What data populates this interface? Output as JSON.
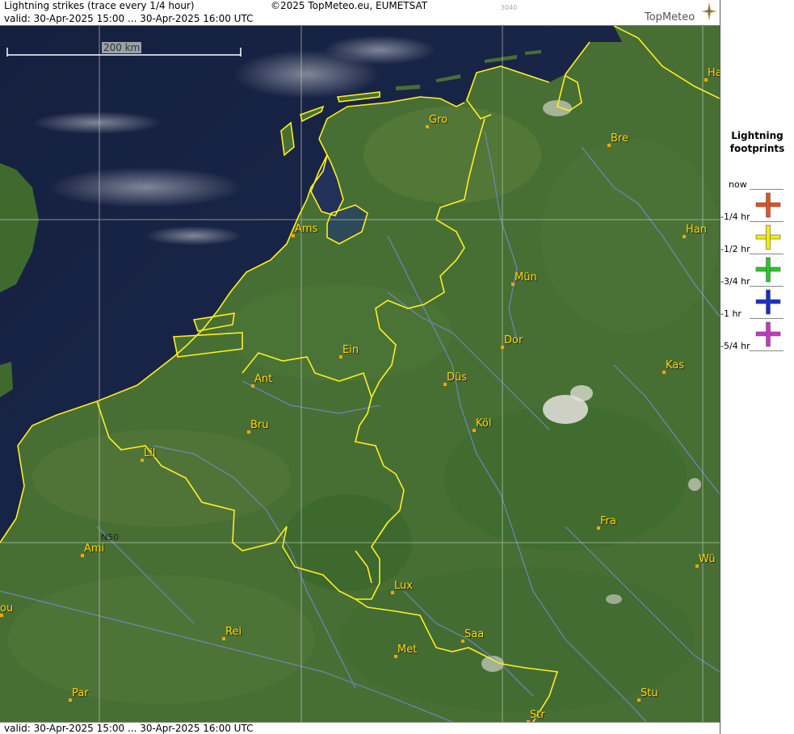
{
  "header": {
    "title": "Lightning strikes (trace every 1/4 hour)",
    "copyright": "©2025 TopMeteo.eu, EUMETSAT",
    "valid": "valid:  30-Apr-2025 15:00 ... 30-Apr-2025 16:00 UTC",
    "small_code": "3040",
    "brand": "TopMeteo"
  },
  "footer": {
    "valid": "valid:  30-Apr-2025 15:00 ... 30-Apr-2025 16:00 UTC"
  },
  "map": {
    "scale_label": "200 km",
    "lat_label": "N50",
    "cities": [
      {
        "name": "Gro",
        "key": "gro"
      },
      {
        "name": "Bre",
        "key": "bre"
      },
      {
        "name": "Ha",
        "key": "ham"
      },
      {
        "name": "Ams",
        "key": "ams"
      },
      {
        "name": "Han",
        "key": "han"
      },
      {
        "name": "Mün",
        "key": "mun"
      },
      {
        "name": "Dor",
        "key": "dor"
      },
      {
        "name": "Ein",
        "key": "ein"
      },
      {
        "name": "Ant",
        "key": "ant"
      },
      {
        "name": "Düs",
        "key": "dus"
      },
      {
        "name": "Kas",
        "key": "kas"
      },
      {
        "name": "Bru",
        "key": "bru"
      },
      {
        "name": "Köl",
        "key": "kol"
      },
      {
        "name": "Lil",
        "key": "lil"
      },
      {
        "name": "Fra",
        "key": "fra"
      },
      {
        "name": "Ami",
        "key": "ami"
      },
      {
        "name": "Wü",
        "key": "wur"
      },
      {
        "name": "Lux",
        "key": "lux"
      },
      {
        "name": "ou",
        "key": "rou"
      },
      {
        "name": "Rei",
        "key": "rei"
      },
      {
        "name": "Saa",
        "key": "saa"
      },
      {
        "name": "Met",
        "key": "met"
      },
      {
        "name": "Par",
        "key": "par"
      },
      {
        "name": "Stu",
        "key": "stu"
      },
      {
        "name": "Str",
        "key": "str"
      }
    ]
  },
  "legend": {
    "title_line1": "Lightning",
    "title_line2": "footprints",
    "labels": [
      "now",
      "-1/4 hr",
      "-1/2 hr",
      "-3/4 hr",
      "-1 hr",
      "-5/4 hr"
    ],
    "colors": [
      "#e8501e",
      "#f2ef00",
      "#22cc22",
      "#1a2ccc",
      "#cc33cc"
    ]
  }
}
